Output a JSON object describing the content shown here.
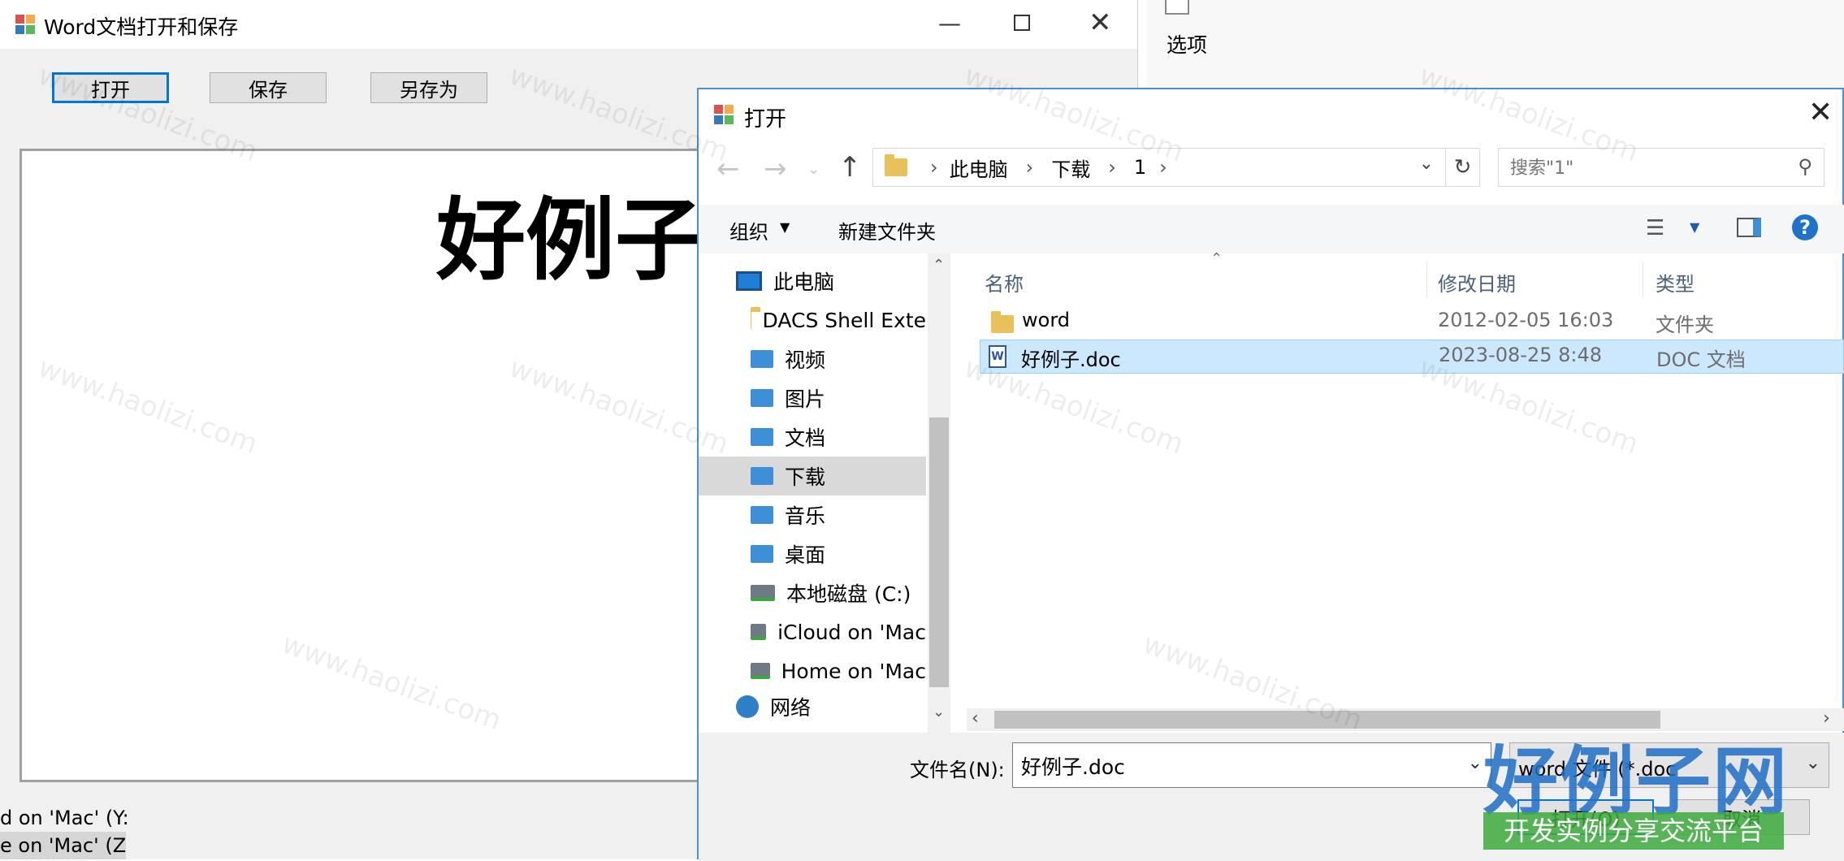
{
  "main_window": {
    "title": "Word文档打开和保存",
    "buttons": {
      "open": "打开",
      "save": "保存",
      "save_as": "另存为"
    },
    "document_text": "好例子",
    "bottom_list": [
      "d on 'Mac' (Y:",
      "e on 'Mac' (Z:"
    ]
  },
  "ribbon_fragment": {
    "options_label": "选项"
  },
  "dialog": {
    "title": "打开",
    "breadcrumb": [
      "此电脑",
      "下载",
      "1"
    ],
    "search_placeholder": "搜索\"1\"",
    "toolbar": {
      "organize": "组织",
      "new_folder": "新建文件夹"
    },
    "nav_tree": [
      {
        "label": "此电脑",
        "icon": "computer-icon"
      },
      {
        "label": "DACS Shell Exte",
        "icon": "folder-icon"
      },
      {
        "label": "视频",
        "icon": "videos-folder-icon"
      },
      {
        "label": "图片",
        "icon": "pictures-folder-icon"
      },
      {
        "label": "文档",
        "icon": "documents-folder-icon"
      },
      {
        "label": "下载",
        "icon": "downloads-folder-icon",
        "selected": true
      },
      {
        "label": "音乐",
        "icon": "music-folder-icon"
      },
      {
        "label": "桌面",
        "icon": "desktop-folder-icon"
      },
      {
        "label": "本地磁盘 (C:)",
        "icon": "drive-icon"
      },
      {
        "label": "iCloud on 'Mac",
        "icon": "network-drive-icon"
      },
      {
        "label": "Home on 'Mac",
        "icon": "network-drive-icon"
      },
      {
        "label": "网络",
        "icon": "network-icon"
      }
    ],
    "columns": {
      "name": "名称",
      "modified": "修改日期",
      "type": "类型"
    },
    "files": [
      {
        "name": "word",
        "modified": "2012-02-05 16:03",
        "type": "文件夹",
        "icon": "folder-icon"
      },
      {
        "name": "好例子.doc",
        "modified": "2023-08-25 8:48",
        "type": "DOC 文档",
        "icon": "word-doc-icon",
        "selected": true
      }
    ],
    "filename_label": "文件名(N):",
    "filename_value": "好例子.doc",
    "filter_value": "word 文件 (*.doc",
    "open_button": "打开(O)",
    "cancel_button": "取消"
  },
  "watermark": {
    "text": "www.haolizi.com",
    "logo": "好例子网",
    "tagline": "开发实例分享交流平台"
  }
}
